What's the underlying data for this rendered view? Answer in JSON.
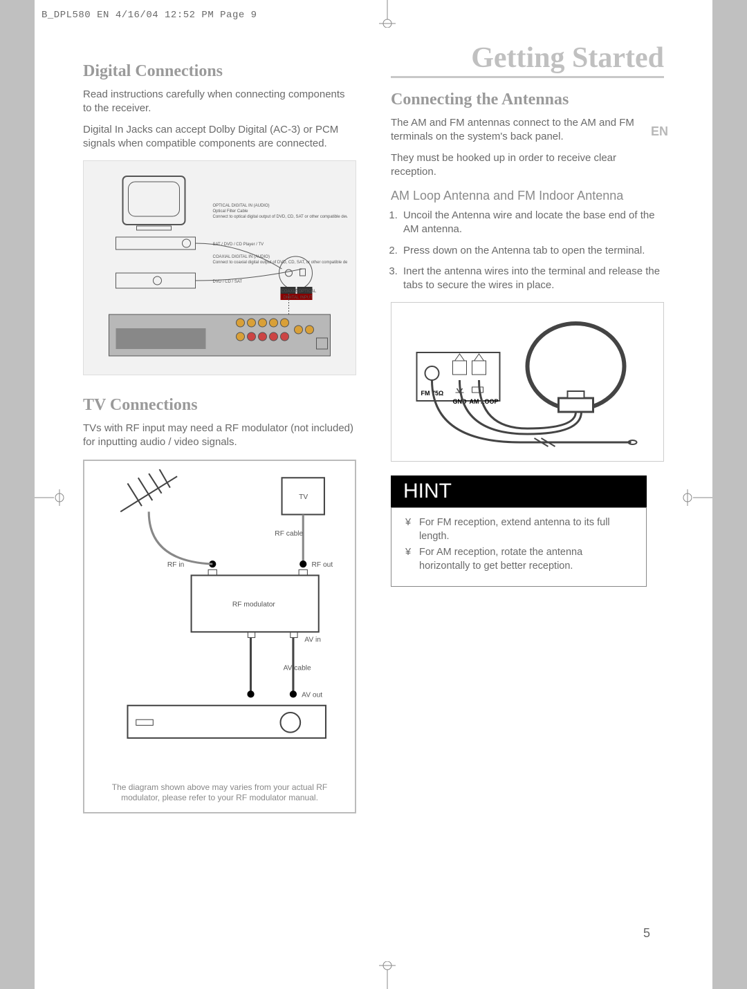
{
  "print_header": "B_DPL580  EN   4/16/04  12:52 PM  Page 9",
  "chapter_title": "Getting Started",
  "lang_badge": "EN",
  "page_num": "5",
  "left": {
    "section1_title": "Digital Connections",
    "section1_p1": "Read instructions carefully when connecting components to the receiver.",
    "section1_p2": "Digital In Jacks can accept Dolby Digital (AC-3) or PCM signals when compatible components are connected.",
    "diagram1": {
      "label_optical_title": "OPTICAL DIGITAL IN (AUDIO)",
      "label_optical_sub": "Optical Filter Cable",
      "label_optical_desc": "Connect to optical digital output of DVD, CD, SAT or other compatible devices.",
      "label_sat": "SAT / DVD / CD Player / TV",
      "label_coax_title": "COAXIAL DIGITAL IN (AUDIO)",
      "label_coax_desc": "Connect to coaxial digital output of DVD, CD, SAT, or other compatible devices.",
      "label_dvd": "DVD / CD / SAT",
      "label_port_coax": "COAXIAL",
      "label_port_opt": "OPTICAL",
      "label_port_group": "DIGITAL INPUT"
    },
    "section2_title": "TV Connections",
    "section2_p1": "TVs with RF input may need a RF modulator (not included) for inputting audio / video signals.",
    "diagram2": {
      "tv": "TV",
      "rf_cable": "RF cable",
      "rf_in": "RF in",
      "rf_out": "RF out",
      "rf_mod": "RF modulator",
      "av_in": "AV in",
      "av_cable": "AV cable",
      "av_out": "AV out",
      "caption": "The diagram shown above may varies from your actual RF modulator, please refer to your RF modulator manual."
    }
  },
  "right": {
    "section1_title": "Connecting the Antennas",
    "section1_p1": "The AM and FM antennas connect to the AM and FM terminals on the system's back panel.",
    "section1_p2": "They must be hooked up in order to receive clear reception.",
    "sub1_title": "AM Loop Antenna and FM Indoor Antenna",
    "steps": [
      "Uncoil the Antenna wire and locate the base end of the AM antenna.",
      "Press down on the Antenna tab to open the terminal.",
      "Inert the antenna wires into the terminal and release the tabs to secure the wires in place."
    ],
    "diagram1": {
      "fm": "FM 75Ω",
      "gnd": "GND",
      "amloop": "AM LOOP"
    },
    "hint_title": "HINT",
    "hint_items": [
      "For FM reception, extend antenna to its full length.",
      "For AM reception, rotate the antenna horizontally to get better reception."
    ]
  }
}
